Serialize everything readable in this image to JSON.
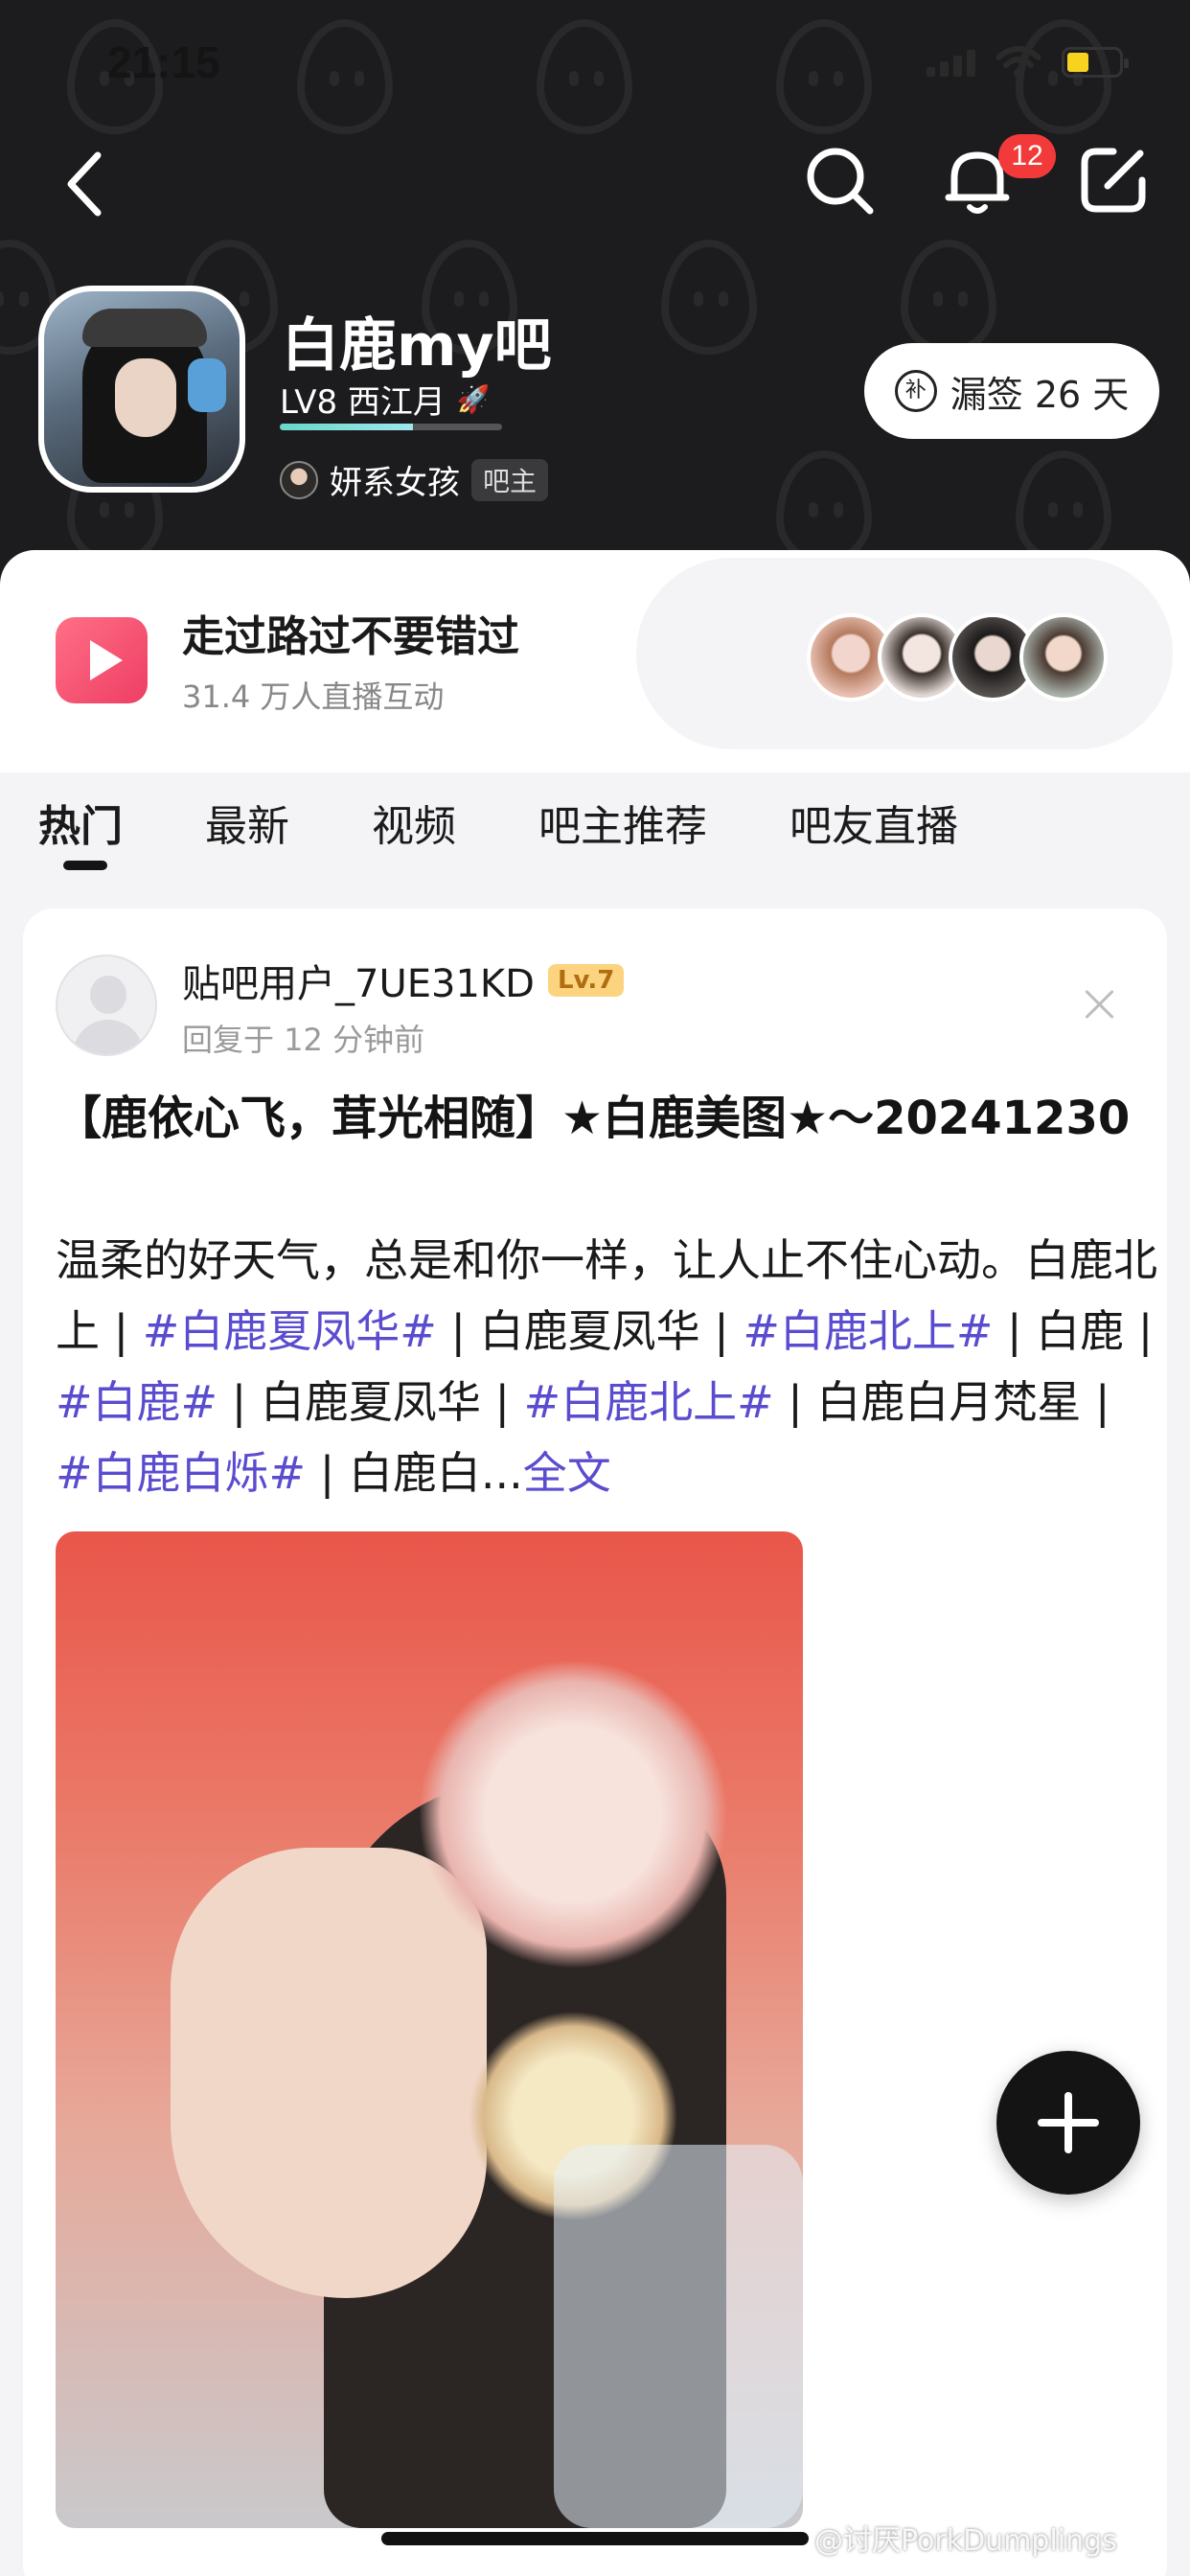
{
  "status_bar": {
    "time": "21:15"
  },
  "header": {
    "notification_count": "12",
    "forum_name": "白鹿my吧",
    "level_text": "LV8 西江月",
    "level_progress": 0.6,
    "owner_name": "妍系女孩",
    "owner_tag": "吧主",
    "sign_button": "漏签 26 天",
    "sign_icon_glyph": "补"
  },
  "live": {
    "title": "走过路过不要错过",
    "subtitle": "31.4 万人直播互动"
  },
  "tabs": [
    {
      "label": "热门",
      "active": true
    },
    {
      "label": "最新"
    },
    {
      "label": "视频"
    },
    {
      "label": "吧主推荐"
    },
    {
      "label": "吧友直播"
    }
  ],
  "post": {
    "username": "贴吧用户_7UE31KD",
    "level_badge": "Lv.7",
    "time": "回复于 12 分钟前",
    "title": "【鹿依心飞，茸光相随】★白鹿美图★～20241230",
    "body_segments": [
      {
        "text": "温柔的好天气，总是和你一样，让人止不住心动。白鹿北上 | "
      },
      {
        "text": "#白鹿夏凤华#",
        "tag": true
      },
      {
        "text": " | 白鹿夏凤华 | "
      },
      {
        "text": "#白鹿北上#",
        "tag": true
      },
      {
        "text": " | 白鹿 | "
      },
      {
        "text": "#白鹿#",
        "tag": true
      },
      {
        "text": " | 白鹿夏凤华 | "
      },
      {
        "text": "#白鹿北上#",
        "tag": true
      },
      {
        "text": " | 白鹿白月梵星 | "
      },
      {
        "text": "#白鹿白烁#",
        "tag": true
      },
      {
        "text": " | 白鹿白..."
      },
      {
        "text": "全文",
        "more": true
      }
    ]
  },
  "watermark": "@讨厌PorkDumplings",
  "colors": {
    "header_bg": "#1c1c1e",
    "tag_color": "#5a4ccf",
    "badge_red": "#f23a3a",
    "live_icon": "#ee3e64"
  },
  "icons": [
    "back-icon",
    "search-icon",
    "bell-icon",
    "edit-icon",
    "rocket-icon",
    "close-icon",
    "plus-icon",
    "live-play-icon"
  ]
}
